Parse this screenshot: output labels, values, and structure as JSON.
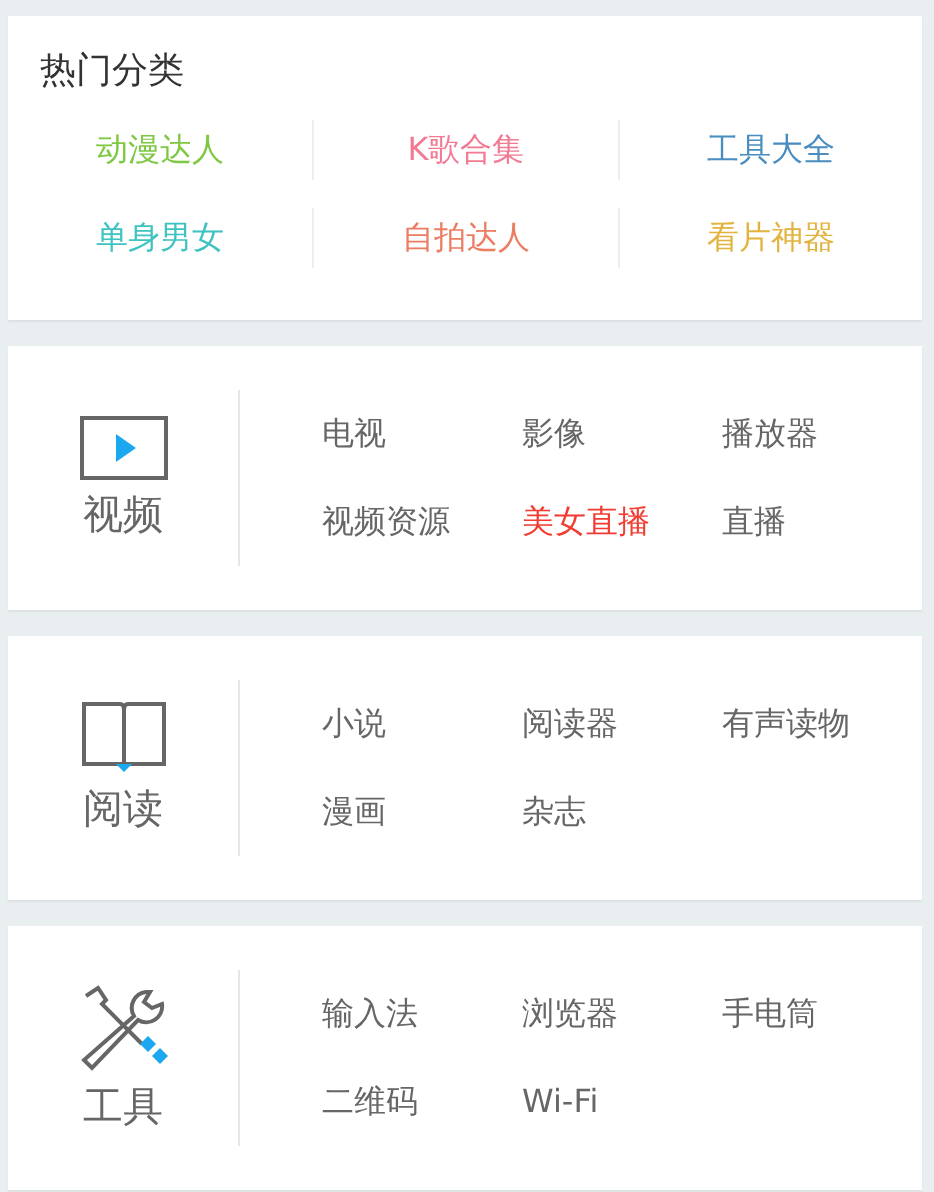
{
  "hot": {
    "title": "热门分类",
    "items": [
      {
        "label": "动漫达人",
        "color": "#7ec843"
      },
      {
        "label": "K歌合集",
        "color": "#f27a93"
      },
      {
        "label": "工具大全",
        "color": "#4a8dc0"
      },
      {
        "label": "单身男女",
        "color": "#3fc3c0"
      },
      {
        "label": "自拍达人",
        "color": "#eb7d63"
      },
      {
        "label": "看片神器",
        "color": "#e2b43f"
      }
    ]
  },
  "sections": [
    {
      "kind": "video",
      "title": "视频",
      "links": [
        {
          "label": "电视",
          "hot": false
        },
        {
          "label": "影像",
          "hot": false
        },
        {
          "label": "播放器",
          "hot": false
        },
        {
          "label": "视频资源",
          "hot": false
        },
        {
          "label": "美女直播",
          "hot": true
        },
        {
          "label": "直播",
          "hot": false
        }
      ]
    },
    {
      "kind": "book",
      "title": "阅读",
      "links": [
        {
          "label": "小说",
          "hot": false
        },
        {
          "label": "阅读器",
          "hot": false
        },
        {
          "label": "有声读物",
          "hot": false
        },
        {
          "label": "漫画",
          "hot": false
        },
        {
          "label": "杂志",
          "hot": false
        }
      ]
    },
    {
      "kind": "tools",
      "title": "工具",
      "links": [
        {
          "label": "输入法",
          "hot": false
        },
        {
          "label": "浏览器",
          "hot": false
        },
        {
          "label": "手电筒",
          "hot": false
        },
        {
          "label": "二维码",
          "hot": false
        },
        {
          "label": "Wi-Fi",
          "hot": false
        }
      ]
    }
  ]
}
